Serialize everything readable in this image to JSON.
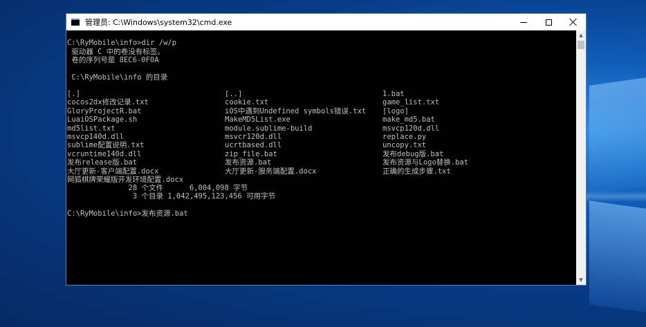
{
  "window": {
    "title": "管理员: C:\\Windows\\system32\\cmd.exe",
    "icon": "cmd-icon"
  },
  "console": {
    "lines": [
      "C:\\RyMobile\\info>dir /w/p",
      " 驱动器 C 中的卷没有标签。",
      " 卷的序列号是 8EC6-0F0A",
      "",
      " C:\\RyMobile\\info 的目录",
      ""
    ],
    "columns": [
      [
        "[.]",
        "cocos2dx修改记录.txt",
        "GloryProjectR.bat",
        "LuaiOSPackage.sh",
        "md5list.txt",
        "msvcp140d.dll",
        "sublime配置说明.txt",
        "vcruntime140d.dll",
        "发布release版.bat",
        "大厅更新-客户端配置.docx",
        "网狐棋牌荣耀版开发环境配置.docx"
      ],
      [
        "[..]",
        "cookie.txt",
        "iOS中遇到Undefined symbols错误.txt",
        "MakeMD5List.exe",
        "module.sublime-build",
        "msvcr120d.dll",
        "ucrtbased.dll",
        "zip_file.bat",
        "发布资源.bat",
        "大厅更新-服务端配置.docx"
      ],
      [
        "1.bat",
        "game_list.txt",
        "[logo]",
        "make_md5.bat",
        "msvcp120d.dll",
        "replace.py",
        "uncopy.txt",
        "发布debug版.bat",
        "发布资源与Logo替换.bat",
        "正确的生成步骤.txt"
      ]
    ],
    "summary_files": "              28 个文件      6,004,098 字节",
    "summary_dirs": "               3 个目录 1,042,495,123,456 可用字节",
    "prompt": "C:\\RyMobile\\info>",
    "typed_command": "发布资源.bat"
  }
}
